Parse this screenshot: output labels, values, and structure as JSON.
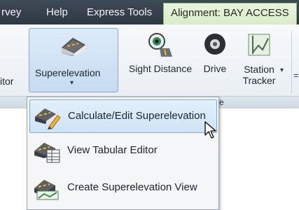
{
  "tabs": [
    {
      "label": "rvey"
    },
    {
      "label": "Help"
    },
    {
      "label": "Express Tools"
    },
    {
      "label": "Alignment: BAY ACCESS"
    }
  ],
  "ribbon": {
    "left_edge_label": "itor",
    "superelevation_label": "Superelevation",
    "superelevation_arrow": "▾",
    "sight_distance_label": "Sight Distance",
    "drive_label": "Drive",
    "station_label": "Station",
    "tracker_label": "Tracker",
    "station_arrow": "▾",
    "right_edge_mark": "=",
    "group_label_tail": "e"
  },
  "menu": {
    "items": [
      {
        "label": "Calculate/Edit Superelevation",
        "icon": "superelevation-edit-icon",
        "hover": true
      },
      {
        "label": "View Tabular Editor",
        "icon": "tabular-editor-icon",
        "hover": false
      },
      {
        "label": "Create Superelevation View",
        "icon": "superelevation-view-icon",
        "hover": false
      }
    ]
  },
  "colors": {
    "tab_bar": "#3f4a57",
    "active_tab": "#e0f0d2",
    "ribbon_bg": "#eef2f6",
    "hover_fill": "#d7e8f8",
    "hover_border": "#7fa8d3"
  }
}
